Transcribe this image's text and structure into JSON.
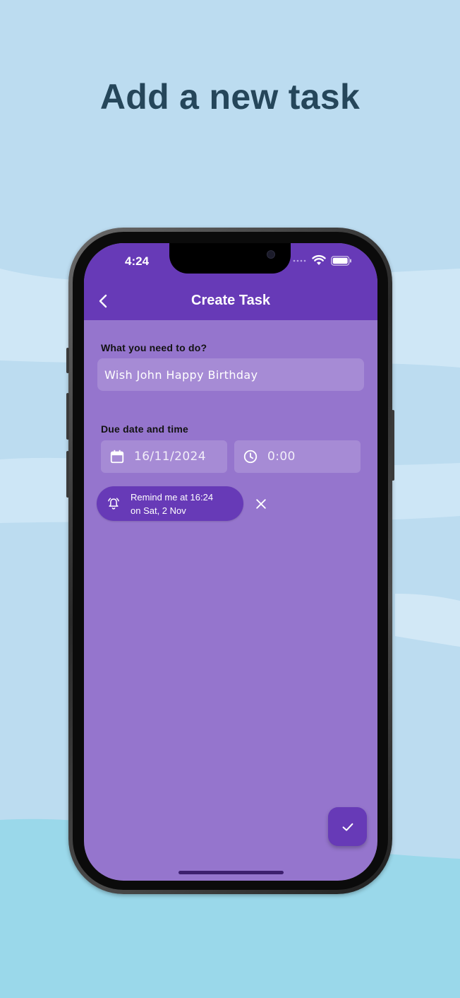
{
  "headline": "Add a new task",
  "status_bar": {
    "time": "4:24",
    "icons": [
      "signal-dots-icon",
      "wifi-icon",
      "battery-icon"
    ]
  },
  "app_bar": {
    "back_icon": "chevron-left-icon",
    "title": "Create Task"
  },
  "form": {
    "task_label": "What you need to do?",
    "task_value": "Wish John Happy Birthday",
    "due_label": "Due date and time",
    "date": {
      "icon": "calendar-icon",
      "value": "16/11/2024"
    },
    "time": {
      "icon": "clock-icon",
      "value": "0:00"
    },
    "reminder": {
      "icon": "alarm-bell-icon",
      "line1": "Remind me at 16:24",
      "line2": "on Sat, 2 Nov"
    },
    "clear_icon": "close-icon"
  },
  "fab": {
    "icon": "check-icon"
  },
  "colors": {
    "background": "#bcdcf0",
    "headline": "#25465a",
    "app_bar": "#673ab7",
    "screen": "#9575cd",
    "accent": "#673ab7"
  }
}
